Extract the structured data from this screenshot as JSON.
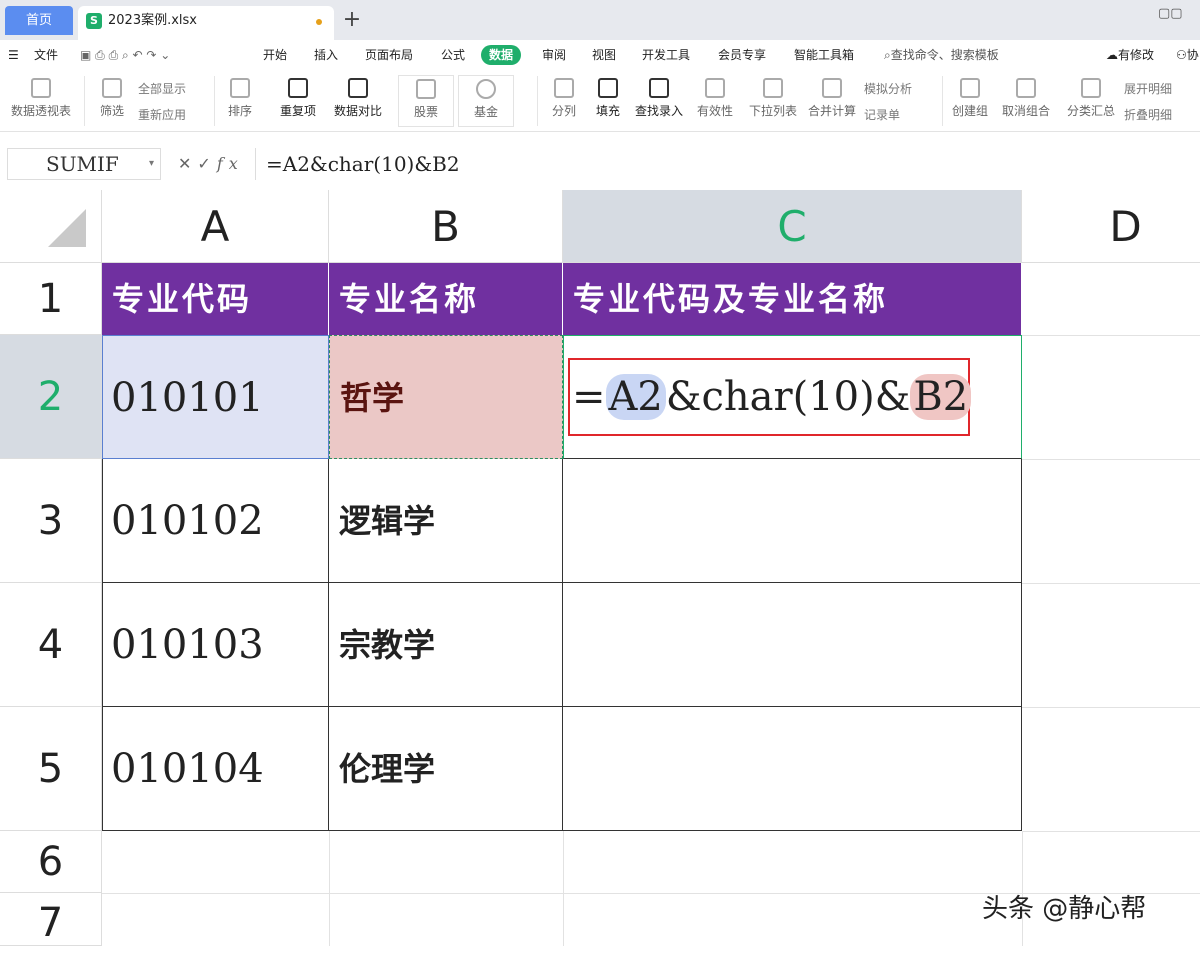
{
  "tabs": {
    "home": "首页",
    "file": "2023案例.xlsx",
    "add": "+"
  },
  "menu": {
    "file": "文件",
    "items": [
      "开始",
      "插入",
      "页面布局",
      "公式",
      "数据",
      "审阅",
      "视图",
      "开发工具",
      "会员专享",
      "智能工具箱"
    ],
    "active": "数据",
    "search": "查找命令、搜索模板",
    "changes": "有修改",
    "extra": "协"
  },
  "ribbon": {
    "pivot": "数据透视表",
    "filter": "筛选",
    "show_all": "全部显示",
    "reapply": "重新应用",
    "sort": "排序",
    "duplicates": "重复项",
    "compare": "数据对比",
    "stock": "股票",
    "fund": "基金",
    "split": "分列",
    "fill": "填充",
    "lookup": "查找录入",
    "validity": "有效性",
    "dropdown": "下拉列表",
    "merge_calc": "合并计算",
    "simulate": "模拟分析",
    "record": "记录单",
    "group": "创建组",
    "ungroup": "取消组合",
    "subtotal": "分类汇总",
    "expand": "展开明细",
    "collapse": "折叠明细"
  },
  "formula_bar": {
    "name_box": "SUMIF",
    "fx_label": "fx",
    "formula": "=A2&char(10)&B2"
  },
  "columns": [
    "A",
    "B",
    "C",
    "D"
  ],
  "rows": [
    "1",
    "2",
    "3",
    "4",
    "5",
    "6",
    "7"
  ],
  "table": {
    "headers": [
      "专业代码",
      "专业名称",
      "专业代码及专业名称"
    ],
    "rows": [
      {
        "code": "010101",
        "name": "哲学"
      },
      {
        "code": "010102",
        "name": "逻辑学"
      },
      {
        "code": "010103",
        "name": "宗教学"
      },
      {
        "code": "010104",
        "name": "伦理学"
      }
    ]
  },
  "edit": {
    "eq": "=",
    "ref_a": "A2",
    "mid": "&char(10)&",
    "ref_b": "B2"
  },
  "watermark": "头条 @静心帮",
  "colors": {
    "accent": "#1fae6b",
    "header_fill": "#7030a0",
    "cell_a2": "#dfe3f4",
    "cell_b2": "#ebc8c6",
    "edit_border": "#e0262b"
  }
}
